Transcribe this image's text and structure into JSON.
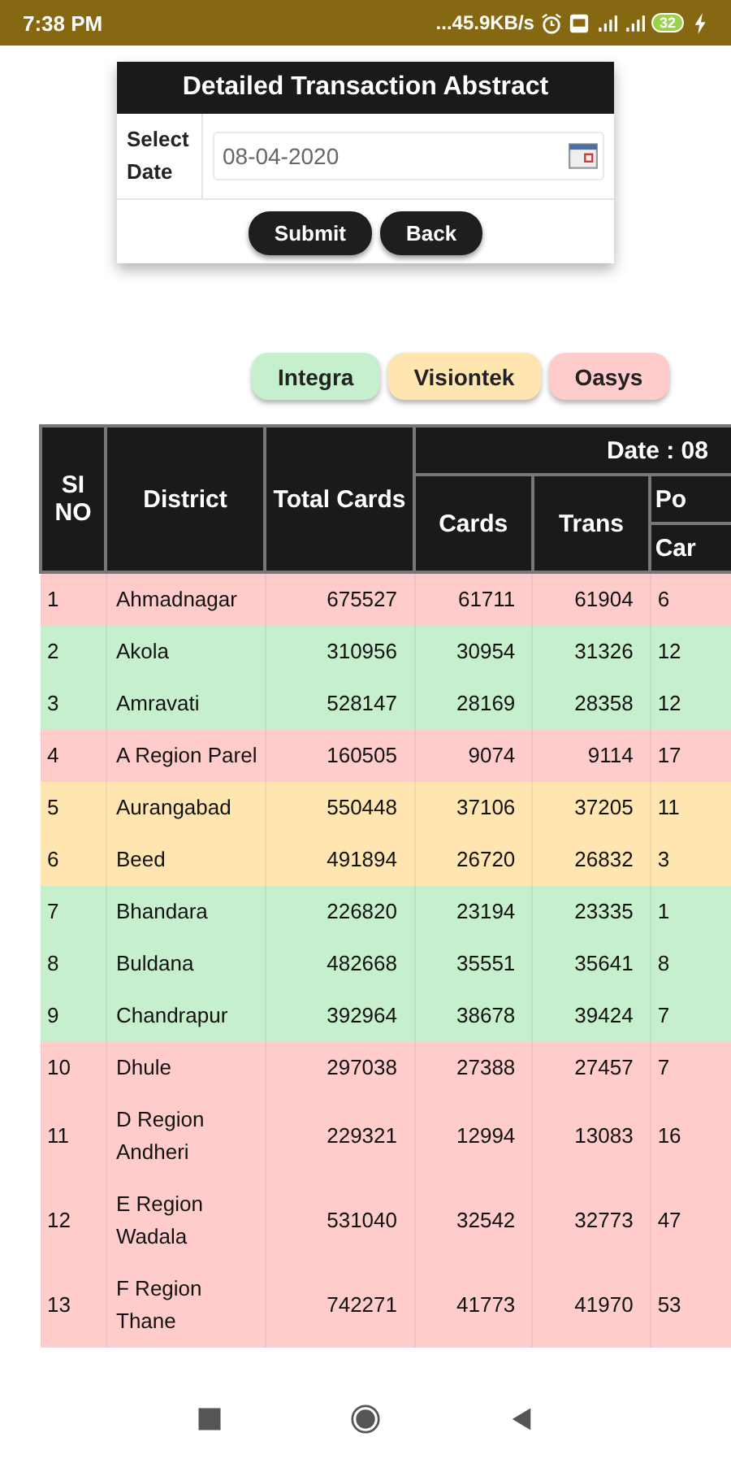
{
  "status_bar": {
    "time": "7:38 PM",
    "network_speed": "...45.9KB/s",
    "battery": "32"
  },
  "form": {
    "title": "Detailed Transaction Abstract",
    "date_label": "Select Date",
    "date_value": "08-04-2020",
    "buttons": [
      "Submit",
      "Back"
    ]
  },
  "legend": [
    {
      "label": "Integra",
      "color": "#c6efce"
    },
    {
      "label": "Visiontek",
      "color": "#ffe5b0"
    },
    {
      "label": "Oasys",
      "color": "#ffcccc"
    }
  ],
  "table": {
    "header": {
      "sl_no": "SI NO",
      "district": "District",
      "total_cards": "Total Cards",
      "date": "Date : 08",
      "cards": "Cards",
      "trans": "Trans",
      "group_6": "Po",
      "column_6": "Car"
    },
    "rows": [
      {
        "cells": [
          "1",
          "Ahmadnagar",
          "675527",
          "61711",
          "61904",
          "6"
        ],
        "color": "#ffcccc"
      },
      {
        "cells": [
          "2",
          "Akola",
          "310956",
          "30954",
          "31326",
          "12"
        ],
        "color": "#c6efce"
      },
      {
        "cells": [
          "3",
          "Amravati",
          "528147",
          "28169",
          "28358",
          "12"
        ],
        "color": "#c6efce"
      },
      {
        "cells": [
          "4",
          "A Region Parel",
          "160505",
          "9074",
          "9114",
          "17"
        ],
        "color": "#ffcccc"
      },
      {
        "cells": [
          "5",
          "Aurangabad",
          "550448",
          "37106",
          "37205",
          "11"
        ],
        "color": "#ffe5b0"
      },
      {
        "cells": [
          "6",
          "Beed",
          "491894",
          "26720",
          "26832",
          "3"
        ],
        "color": "#ffe5b0"
      },
      {
        "cells": [
          "7",
          "Bhandara",
          "226820",
          "23194",
          "23335",
          "1"
        ],
        "color": "#c6efce"
      },
      {
        "cells": [
          "8",
          "Buldana",
          "482668",
          "35551",
          "35641",
          "8"
        ],
        "color": "#c6efce"
      },
      {
        "cells": [
          "9",
          "Chandrapur",
          "392964",
          "38678",
          "39424",
          "7"
        ],
        "color": "#c6efce"
      },
      {
        "cells": [
          "10",
          "Dhule",
          "297038",
          "27388",
          "27457",
          "7"
        ],
        "color": "#ffcccc"
      },
      {
        "cells": [
          "11",
          "D Region Andheri",
          "229321",
          "12994",
          "13083",
          "16"
        ],
        "color": "#ffcccc"
      },
      {
        "cells": [
          "12",
          "E Region Wadala",
          "531040",
          "32542",
          "32773",
          "47"
        ],
        "color": "#ffcccc"
      },
      {
        "cells": [
          "13",
          "F Region Thane",
          "742271",
          "41773",
          "41970",
          "53"
        ],
        "color": "#ffcccc"
      }
    ]
  }
}
